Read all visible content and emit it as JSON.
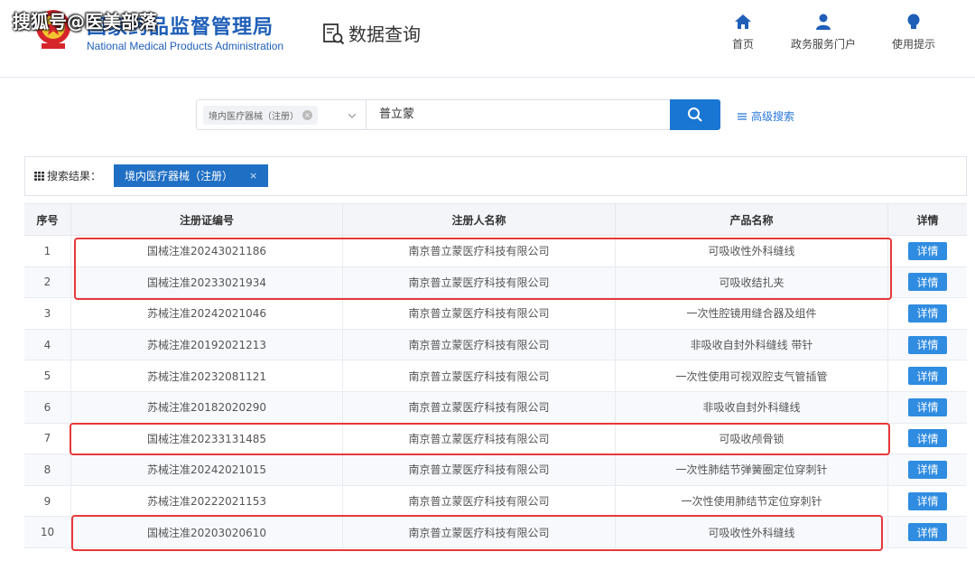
{
  "watermark": "搜狐号@医美部落",
  "header": {
    "agency_cn": "国家药品监督管理局",
    "agency_en": "National Medical Products Administration",
    "page_title": "数据查询",
    "nav": [
      {
        "label": "首页",
        "icon": "home-icon"
      },
      {
        "label": "政务服务门户",
        "icon": "user-icon"
      },
      {
        "label": "使用提示",
        "icon": "bulb-icon"
      }
    ]
  },
  "search": {
    "category_tag": "境内医疗器械（注册）",
    "query": "普立蒙",
    "advanced_label": "高级搜索"
  },
  "results": {
    "label": "搜索结果：",
    "chip": "境内医疗器械（注册）",
    "chip_close": "×"
  },
  "table": {
    "columns": [
      "序号",
      "注册证编号",
      "注册人名称",
      "产品名称",
      "详情"
    ],
    "detail_label": "详情",
    "rows": [
      {
        "idx": "1",
        "reg": "国械注准20243021186",
        "owner": "南京普立蒙医疗科技有限公司",
        "product": "可吸收性外科缝线"
      },
      {
        "idx": "2",
        "reg": "国械注准20233021934",
        "owner": "南京普立蒙医疗科技有限公司",
        "product": "可吸收结扎夹"
      },
      {
        "idx": "3",
        "reg": "苏械注准20242021046",
        "owner": "南京普立蒙医疗科技有限公司",
        "product": "一次性腔镜用缝合器及组件"
      },
      {
        "idx": "4",
        "reg": "苏械注准20192021213",
        "owner": "南京普立蒙医疗科技有限公司",
        "product": "非吸收自封外科缝线 带针"
      },
      {
        "idx": "5",
        "reg": "苏械注准20232081121",
        "owner": "南京普立蒙医疗科技有限公司",
        "product": "一次性使用可视双腔支气管插管"
      },
      {
        "idx": "6",
        "reg": "苏械注准20182020290",
        "owner": "南京普立蒙医疗科技有限公司",
        "product": "非吸收自封外科缝线"
      },
      {
        "idx": "7",
        "reg": "国械注准20233131485",
        "owner": "南京普立蒙医疗科技有限公司",
        "product": "可吸收颅骨锁"
      },
      {
        "idx": "8",
        "reg": "苏械注准20242021015",
        "owner": "南京普立蒙医疗科技有限公司",
        "product": "一次性肺结节弹簧圈定位穿刺针"
      },
      {
        "idx": "9",
        "reg": "苏械注准20222021153",
        "owner": "南京普立蒙医疗科技有限公司",
        "product": "一次性使用肺结节定位穿刺针"
      },
      {
        "idx": "10",
        "reg": "国械注准20203020610",
        "owner": "南京普立蒙医疗科技有限公司",
        "product": "可吸收性外科缝线"
      }
    ]
  },
  "colors": {
    "brand_blue": "#1f5fb8",
    "button_blue": "#1976d2",
    "highlight_red": "#e8383a"
  }
}
